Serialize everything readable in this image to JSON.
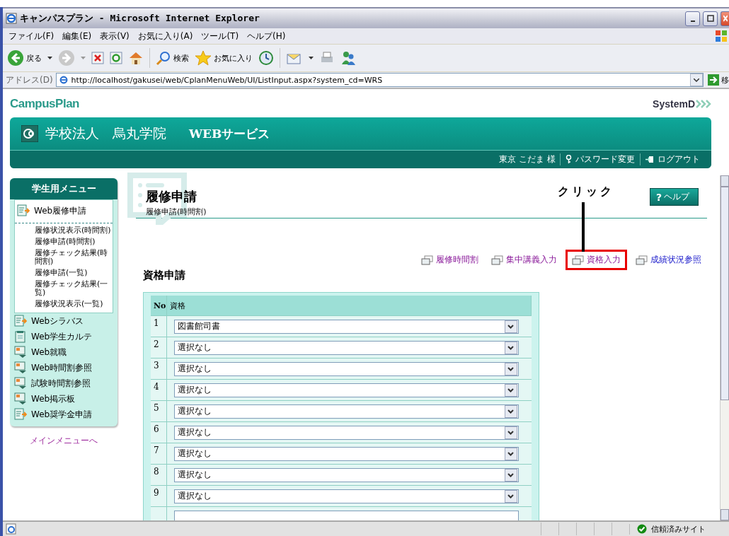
{
  "window": {
    "title": "キャンパスプラン - Microsoft Internet Explorer"
  },
  "menu": [
    "ファイル(F)",
    "編集(E)",
    "表示(V)",
    "お気に入り(A)",
    "ツール(T)",
    "ヘルプ(H)"
  ],
  "toolbar": {
    "back": "戻る",
    "search": "検索",
    "favorites": "お気に入り"
  },
  "address": {
    "label": "アドレス(D)",
    "url": "http://localhost/gakusei/web/CplanMenuWeb/UI/ListInput.aspx?system_cd=WRS",
    "go": "移"
  },
  "page": {
    "logo": "CampusPlan",
    "vendor_logo": "SystemD",
    "header": {
      "school": "学校法人　烏丸学院",
      "service": "WEBサービス",
      "user": "東京 こだま 様",
      "password": "パスワード変更",
      "logout": "ログアウト"
    },
    "sidebar": {
      "title": "学生用メニュー",
      "items": [
        {
          "label": "Web履修申請",
          "expanded": true,
          "children": [
            {
              "label": "履修状況表示(時間割)"
            },
            {
              "label": "履修申請(時間割)"
            },
            {
              "label": "履修チェック結果(時間割)"
            },
            {
              "label": "履修申請(一覧)"
            },
            {
              "label": "履修チェック結果(一覧)"
            },
            {
              "label": "履修状況表示(一覧)"
            }
          ]
        },
        {
          "label": "Webシラバス",
          "expanded": false
        },
        {
          "label": "Web学生カルテ",
          "expanded": false
        },
        {
          "label": "Web就職",
          "expanded": false
        },
        {
          "label": "Web時間割参照",
          "expanded": false
        },
        {
          "label": "試験時間割参照",
          "expanded": false
        },
        {
          "label": "Web掲示板",
          "expanded": false
        },
        {
          "label": "Web奨学金申請",
          "expanded": false
        }
      ],
      "main_link": "メインメニューへ"
    },
    "title": "履修申請",
    "subtitle": "履修申請(時間割)",
    "help": {
      "icon": "?",
      "label": "ヘルプ"
    },
    "links": [
      {
        "label": "履修時間割",
        "visited": true,
        "highlighted": false
      },
      {
        "label": "集中講義入力",
        "visited": true,
        "highlighted": false
      },
      {
        "label": "資格入力",
        "visited": true,
        "highlighted": true
      },
      {
        "label": "成績状況参照",
        "visited": false,
        "highlighted": false
      }
    ],
    "section": "資格申請",
    "table": {
      "columns": [
        "No",
        "資格"
      ],
      "rows": [
        {
          "no": "1",
          "value": "図書館司書"
        },
        {
          "no": "2",
          "value": "選択なし"
        },
        {
          "no": "3",
          "value": "選択なし"
        },
        {
          "no": "4",
          "value": "選択なし"
        },
        {
          "no": "5",
          "value": "選択なし"
        },
        {
          "no": "6",
          "value": "選択なし"
        },
        {
          "no": "7",
          "value": "選択なし"
        },
        {
          "no": "8",
          "value": "選択なし"
        },
        {
          "no": "9",
          "value": "選択なし"
        }
      ]
    }
  },
  "annotation": {
    "label": "クリック"
  },
  "status_bar": {
    "zone": "信頼済みサイト"
  }
}
